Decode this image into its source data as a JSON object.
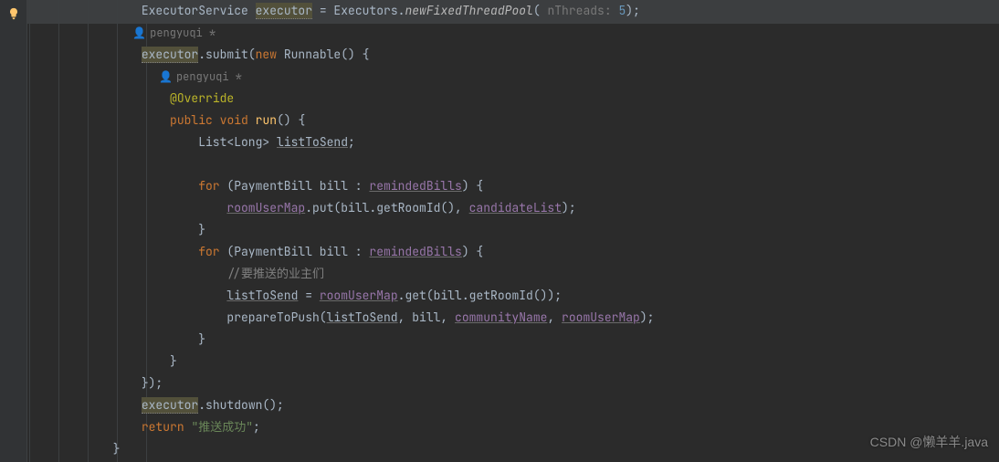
{
  "bulb_icon": "lightbulb-icon",
  "guides_x": [
    2,
    34,
    66,
    98,
    130
  ],
  "code": {
    "l1": {
      "pre": "                ",
      "t1": "ExecutorService ",
      "warn": "executor",
      "t2": " = Executors.",
      "call": "newFixedThreadPool",
      "t3": "(",
      "hint": " nThreads: ",
      "num": "5",
      "t4": ");"
    },
    "l2": {
      "pre": "                ",
      "author": "pengyuqi *"
    },
    "l3": {
      "pre": "                ",
      "warn": "executor",
      "t1": ".submit(",
      "kw": "new",
      "t2": " Runnable() {"
    },
    "l4": {
      "pre": "                    ",
      "author": "pengyuqi *"
    },
    "l5": {
      "pre": "                    ",
      "anno": "@Override"
    },
    "l6": {
      "pre": "                    ",
      "kw1": "public",
      "sp": " ",
      "kw2": "void",
      "t1": " ",
      "fn": "run",
      "t2": "() {"
    },
    "l7": {
      "pre": "                        ",
      "t1": "List<Long> ",
      "var": "listToSend",
      "t2": ";"
    },
    "l8": {
      "pre": ""
    },
    "l9": {
      "pre": "                        ",
      "kw": "for",
      "t1": " (PaymentBill bill : ",
      "fld": "remindedBills",
      "t2": ") {"
    },
    "l10": {
      "pre": "                            ",
      "fld1": "roomUserMap",
      "t1": ".put(bill.getRoomId(), ",
      "fld2": "candidateList",
      "t2": ");"
    },
    "l11": {
      "pre": "                        ",
      "t1": "}"
    },
    "l12": {
      "pre": "                        ",
      "kw": "for",
      "t1": " (PaymentBill bill : ",
      "fld": "remindedBills",
      "t2": ") {"
    },
    "l13": {
      "pre": "                            ",
      "cmt": "//要推送的业主们"
    },
    "l14": {
      "pre": "                            ",
      "var": "listToSend",
      "t1": " = ",
      "fld": "roomUserMap",
      "t2": ".get(bill.getRoomId());"
    },
    "l15": {
      "pre": "                            ",
      "t1": "prepareToPush(",
      "var": "listToSend",
      "t2": ", bill, ",
      "fld1": "communityName",
      "t3": ", ",
      "fld2": "roomUserMap",
      "t4": ");"
    },
    "l16": {
      "pre": "                        ",
      "t1": "}"
    },
    "l17": {
      "pre": "                    ",
      "t1": "}"
    },
    "l18": {
      "pre": "                ",
      "t1": "});"
    },
    "l19": {
      "pre": "                ",
      "warn": "executor",
      "t1": ".shutdown();"
    },
    "l20": {
      "pre": "                ",
      "kw": "return",
      "t1": " ",
      "str": "\"推送成功\"",
      "t2": ";"
    },
    "l21": {
      "pre": "            ",
      "t1": "}"
    }
  },
  "watermark": "CSDN @懒羊羊.java"
}
